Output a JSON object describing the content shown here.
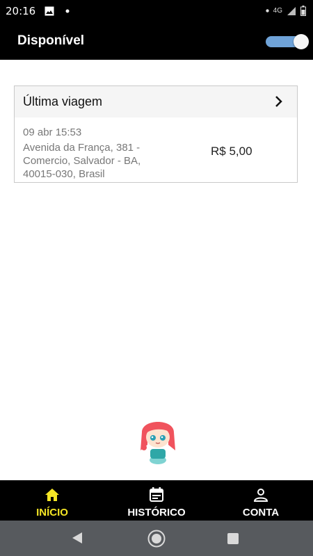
{
  "status_bar": {
    "time": "20:16",
    "network": "4G",
    "icons": [
      "image-icon",
      "notification-dot-icon",
      "signal-icon",
      "battery-icon"
    ]
  },
  "header": {
    "title": "Disponível",
    "availability_toggle": {
      "on": true
    }
  },
  "last_trip": {
    "title": "Última viagem",
    "date": "09 abr 15:53",
    "address": "Avenida da França, 381 - Comercio, Salvador - BA, 40015-030, Brasil",
    "price": "R$ 5,00"
  },
  "bottom_nav": {
    "items": [
      {
        "label": "INÍCIO",
        "icon": "home-icon",
        "active": true
      },
      {
        "label": "HISTÓRICO",
        "icon": "calendar-icon",
        "active": false
      },
      {
        "label": "CONTA",
        "icon": "person-icon",
        "active": false
      }
    ]
  },
  "system_nav": {
    "icons": [
      "back-icon",
      "home-circle-icon",
      "recents-icon"
    ]
  },
  "colors": {
    "bar_bg": "#000000",
    "active_accent": "#f5e625",
    "toggle_track": "#6fa3d8",
    "system_nav_bg": "#575a5e"
  }
}
